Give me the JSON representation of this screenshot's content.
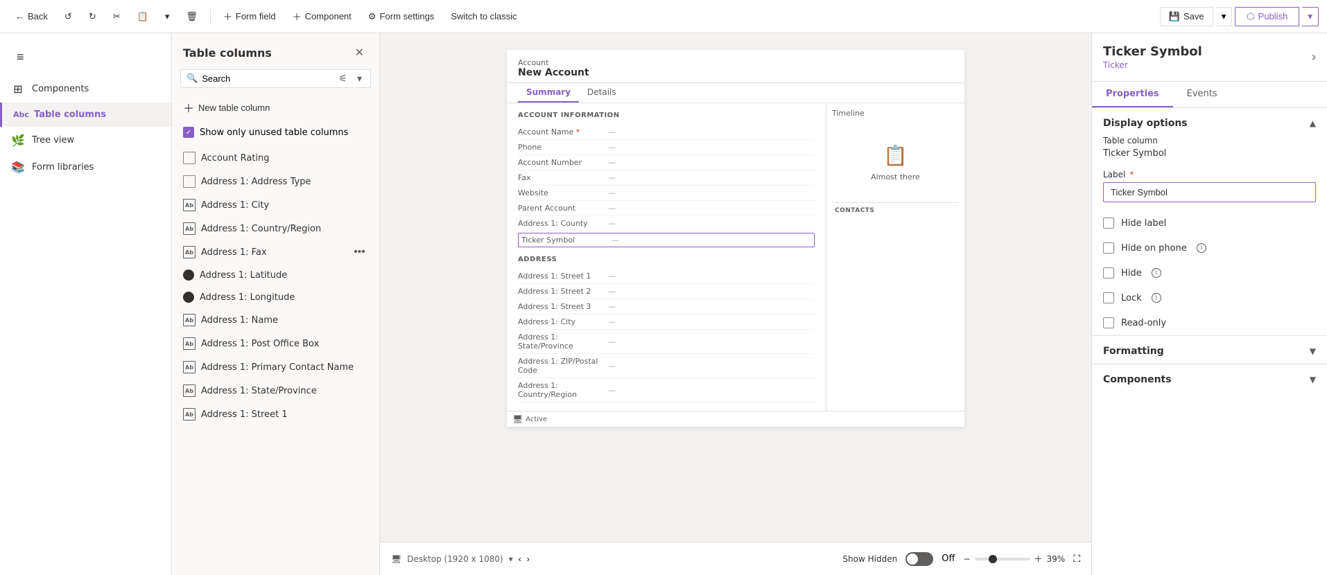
{
  "toolbar": {
    "back_label": "Back",
    "form_field_label": "Form field",
    "component_label": "Component",
    "form_settings_label": "Form settings",
    "switch_classic_label": "Switch to classic",
    "save_label": "Save",
    "publish_label": "Publish"
  },
  "sidebar": {
    "menu_icon": "≡",
    "items": [
      {
        "id": "components",
        "label": "Components",
        "icon": "⊞"
      },
      {
        "id": "table-columns",
        "label": "Table columns",
        "icon": "Abc",
        "active": true
      },
      {
        "id": "tree-view",
        "label": "Tree view",
        "icon": "🌲"
      },
      {
        "id": "form-libraries",
        "label": "Form libraries",
        "icon": "📚"
      }
    ]
  },
  "panel": {
    "title": "Table columns",
    "search_placeholder": "Search",
    "new_column_label": "New table column",
    "show_unused_label": "Show only unused table columns",
    "columns": [
      {
        "id": "account-rating",
        "label": "Account Rating",
        "icon_type": "box"
      },
      {
        "id": "address-type",
        "label": "Address 1: Address Type",
        "icon_type": "box"
      },
      {
        "id": "address-city",
        "label": "Address 1: City",
        "icon_type": "text"
      },
      {
        "id": "address-country",
        "label": "Address 1: Country/Region",
        "icon_type": "text"
      },
      {
        "id": "address-fax",
        "label": "Address 1: Fax",
        "icon_type": "text",
        "show_more": true
      },
      {
        "id": "address-latitude",
        "label": "Address 1: Latitude",
        "icon_type": "circle"
      },
      {
        "id": "address-longitude",
        "label": "Address 1: Longitude",
        "icon_type": "circle"
      },
      {
        "id": "address-name",
        "label": "Address 1: Name",
        "icon_type": "text"
      },
      {
        "id": "address-pobox",
        "label": "Address 1: Post Office Box",
        "icon_type": "text"
      },
      {
        "id": "address-primary-contact",
        "label": "Address 1: Primary Contact Name",
        "icon_type": "text"
      },
      {
        "id": "address-state",
        "label": "Address 1: State/Province",
        "icon_type": "text"
      },
      {
        "id": "address-street1",
        "label": "Address 1: Street 1",
        "icon_type": "text"
      }
    ]
  },
  "form_preview": {
    "title": "New Account",
    "breadcrumb": "Account",
    "tabs": [
      "Summary",
      "Details"
    ],
    "active_tab": "Summary",
    "sections": {
      "account_info": {
        "title": "ACCOUNT INFORMATION",
        "fields": [
          {
            "label": "Account Name",
            "value": "...",
            "required": true
          },
          {
            "label": "Phone",
            "value": "..."
          },
          {
            "label": "Account Number",
            "value": "..."
          },
          {
            "label": "Fax",
            "value": "..."
          },
          {
            "label": "Website",
            "value": "..."
          },
          {
            "label": "Parent Account",
            "value": "..."
          },
          {
            "label": "Address 1: County",
            "value": "..."
          },
          {
            "label": "Ticker Symbol",
            "value": "...",
            "highlighted": true
          }
        ]
      },
      "address": {
        "title": "ADDRESS",
        "fields": [
          {
            "label": "Address 1: Street 1",
            "value": "..."
          },
          {
            "label": "Address 1: Street 2",
            "value": "..."
          },
          {
            "label": "Address 1: Street 3",
            "value": "..."
          },
          {
            "label": "Address 1: City",
            "value": "..."
          },
          {
            "label": "Address 1: State/Province",
            "value": "..."
          },
          {
            "label": "Address 1: ZIP/Postal Code",
            "value": "..."
          },
          {
            "label": "Address 1: Country/Region",
            "value": "..."
          }
        ]
      }
    },
    "timeline_title": "Timeline",
    "timeline_placeholder": "Almost there",
    "contacts_label": "CONTACTS",
    "footer": {
      "device_label": "Desktop (1920 x 1080)",
      "show_hidden_label": "Show Hidden",
      "toggle_state": "Off",
      "zoom_percent": "39%",
      "active_label": "Active"
    }
  },
  "right_panel": {
    "title": "Ticker Symbol",
    "subtitle": "Ticker",
    "tabs": [
      "Properties",
      "Events"
    ],
    "active_tab": "Properties",
    "display_options": {
      "title": "Display options",
      "table_column_label": "Table column",
      "table_column_value": "Ticker Symbol",
      "label_field_label": "Label",
      "label_field_value": "Ticker Symbol",
      "options": [
        {
          "id": "hide-label",
          "label": "Hide label",
          "checked": false
        },
        {
          "id": "hide-on-phone",
          "label": "Hide on phone",
          "checked": false,
          "has_info": true
        },
        {
          "id": "hide",
          "label": "Hide",
          "checked": false,
          "has_info": true
        },
        {
          "id": "lock",
          "label": "Lock",
          "checked": false,
          "has_info": true
        },
        {
          "id": "read-only",
          "label": "Read-only",
          "checked": false
        }
      ]
    },
    "formatting": {
      "title": "Formatting"
    },
    "components": {
      "title": "Components"
    }
  }
}
